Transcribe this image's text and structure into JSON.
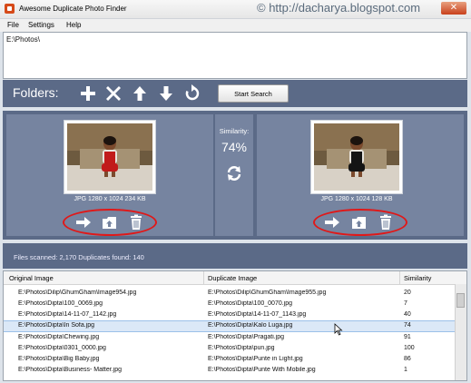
{
  "window": {
    "title": "Awesome Duplicate Photo Finder",
    "close_glyph": "✕"
  },
  "watermark": "© http://dacharya.blogspot.com",
  "menu": [
    "File",
    "Settings",
    "Help"
  ],
  "folders": {
    "entries": [
      "E:\\Photos\\"
    ]
  },
  "toolbar": {
    "label": "Folders:",
    "icons": [
      "add-icon",
      "remove-icon",
      "move-up-icon",
      "move-down-icon",
      "reset-icon"
    ],
    "start_label": "Start Search"
  },
  "compare": {
    "left": {
      "caption": "JPG  1280 x 1024  234 KB"
    },
    "right": {
      "caption": "JPG  1280 x 1024  128 KB"
    },
    "similarity_label": "Similarity:",
    "similarity_value": "74%"
  },
  "status": {
    "text": "Files scanned: 2,170    Duplicates found: 140"
  },
  "table": {
    "columns": [
      "Original Image",
      "Duplicate Image",
      "Similarity"
    ],
    "rows": [
      {
        "original": "E:\\Photos\\Dilip\\GhumGham\\Image954.jpg",
        "duplicate": "E:\\Photos\\Dilip\\GhumGham\\Image955.jpg",
        "similarity": "20"
      },
      {
        "original": "E:\\Photos\\Dipta\\100_0069.jpg",
        "duplicate": "E:\\Photos\\Dipta\\100_0070.jpg",
        "similarity": "7"
      },
      {
        "original": "E:\\Photos\\Dipta\\14-11-07_1142.jpg",
        "duplicate": "E:\\Photos\\Dipta\\14-11-07_1143.jpg",
        "similarity": "40"
      },
      {
        "original": "E:\\Photos\\Dipta\\In Sofa.jpg",
        "duplicate": "E:\\Photos\\Dipta\\Kalo Luga.jpg",
        "similarity": "74",
        "selected": true
      },
      {
        "original": "E:\\Photos\\Dipta\\Chewing.jpg",
        "duplicate": "E:\\Photos\\Dipta\\Pragati.jpg",
        "similarity": "91"
      },
      {
        "original": "E:\\Photos\\Dipta\\0301_0000.jpg",
        "duplicate": "E:\\Photos\\Dipta\\pun.jpg",
        "similarity": "100"
      },
      {
        "original": "E:\\Photos\\Dipta\\Big Baby.jpg",
        "duplicate": "E:\\Photos\\Dipta\\Punte in Light.jpg",
        "similarity": "86"
      },
      {
        "original": "E:\\Photos\\Dipta\\Business- Matter.jpg",
        "duplicate": "E:\\Photos\\Dipta\\Punte With Mobile.jpg",
        "similarity": "1"
      }
    ]
  }
}
